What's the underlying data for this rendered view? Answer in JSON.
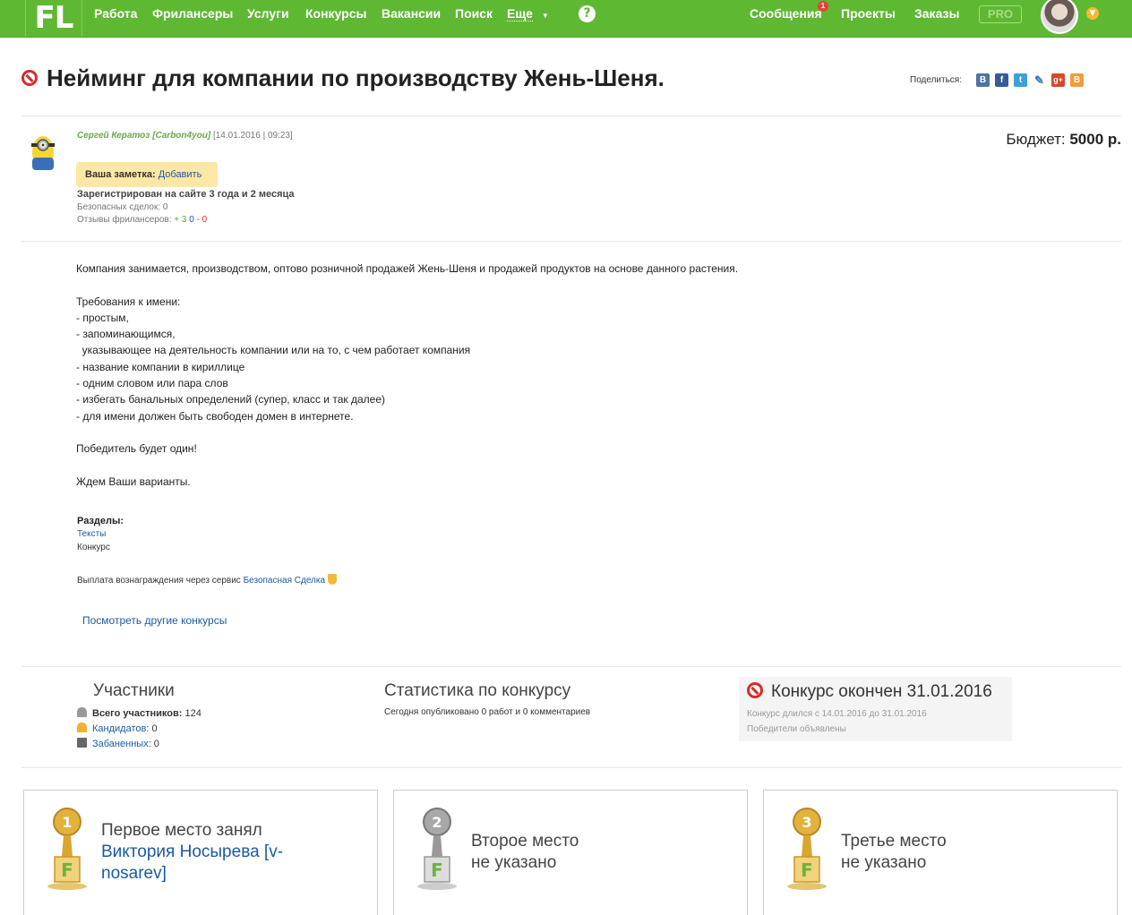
{
  "nav": {
    "logo": "FL",
    "items": [
      "Работа",
      "Фрилансеры",
      "Услуги",
      "Конкурсы",
      "Вакансии",
      "Поиск"
    ],
    "more": "Еще",
    "help": "?",
    "right": [
      "Сообщения",
      "Проекты",
      "Заказы"
    ],
    "messages_badge": "1",
    "pro": "PRO"
  },
  "project": {
    "title": "Нейминг для компании по производству Жень-Шеня.",
    "share_label": "Поделиться:",
    "author_name": "Сергей Кератоз",
    "author_login": "[Carbon4you]",
    "date": "[14.01.2016 | 09:23]",
    "budget_label": "Бюджет:",
    "budget_value": "5000 р.",
    "note_label": "Ваша заметка:",
    "note_link": "Добавить",
    "registered": "Зарегистрирован на сайте 3 года и 2 месяца",
    "safe_deals": "Безопасных сделок: 0",
    "reviews_label": "Отзывы фрилансеров:",
    "reviews_pos": "+ 3",
    "reviews_neu": "0",
    "reviews_neg": "- 0",
    "description": "Компания занимается, производством, оптово розничной продажей Жень-Шеня и продажей продуктов на основе данного растения.\n\nТребования к имени:\n- простым,\n- запоминающимся,\n  указывающее на деятельность компании или на то, с чем работает компания\n- название компании в кириллице\n- одним словом или пара слов\n- избегать банальных определений (супер, класс и так далее)\n- для имени должен быть свободен домен в интернете.\n\nПобедитель будет один!\n\nЖдем Ваши варианты.",
    "sections_label": "Разделы:",
    "section_link": "Тексты",
    "section_sub": "Конкурс",
    "payment_text": "Выплата вознаграждения через сервис",
    "payment_link": "Безопасная Сделка",
    "other_link": "Посмотреть другие конкурсы"
  },
  "stats": {
    "participants_title": "Участники",
    "total_label": "Всего участников:",
    "total_value": "124",
    "candidates_label": "Кандидатов",
    "candidates_value": ": 0",
    "banned_label": "Забаненных",
    "banned_value": ": 0",
    "contest_title": "Статистика по конкурсу",
    "contest_text": "Сегодня опубликовано 0 работ и 0 комментариев",
    "ended_title": "Конкурс окончен 31.01.2016",
    "ended_dates": "Конкурс длился с 14.01.2016 до 31.01.2016",
    "ended_winners": "Победители объявлены"
  },
  "places": {
    "first_label": "Первое место занял",
    "first_winner": "Виктория Носырева [v-nosarev]",
    "second_label": "Второе место",
    "second_status": "не указано",
    "third_label": "Третье место",
    "third_status": "не указано",
    "trophy_numbers": [
      "1",
      "2",
      "3"
    ],
    "trophy_letter": "F"
  },
  "colors": {
    "nav_green": "#5fb832",
    "link_blue": "#1a5aa6",
    "ban_red": "#d62b2b",
    "note_yellow": "#fce7a5",
    "gold": "#e3b23c",
    "silver": "#9a9a9a"
  }
}
